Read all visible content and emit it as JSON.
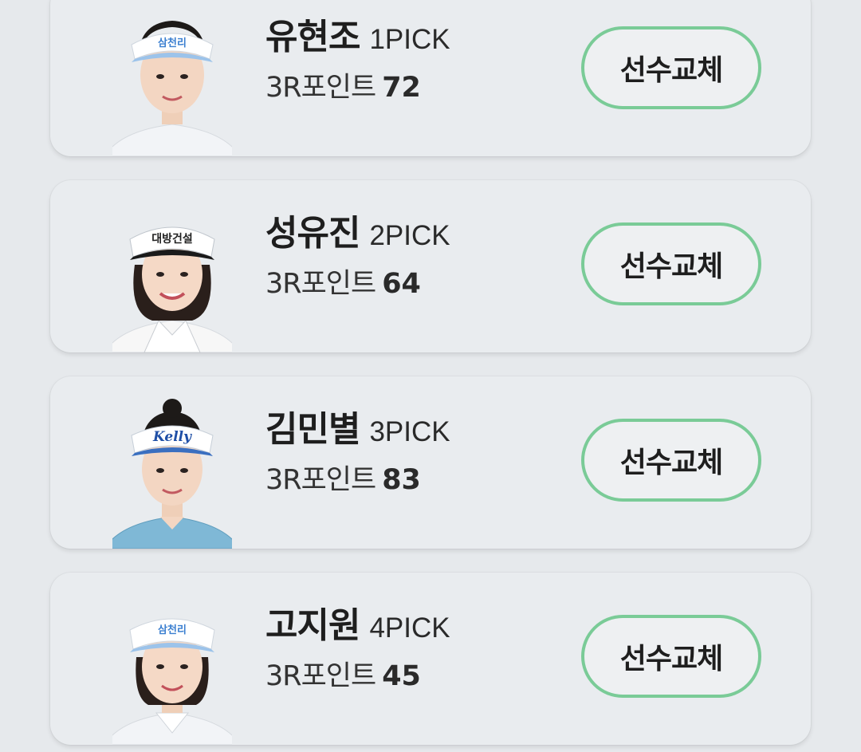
{
  "players": [
    {
      "name": "유현조",
      "pick": "1PICK",
      "points_label": "3R포인트",
      "points": "72",
      "button_label": "선수교체",
      "visor_text": "삼천리",
      "visor_color": "#3b7fd0",
      "shirt_color": "#f2f4f7"
    },
    {
      "name": "성유진",
      "pick": "2PICK",
      "points_label": "3R포인트",
      "points": "64",
      "button_label": "선수교체",
      "visor_text": "대방건설",
      "visor_color": "#222222",
      "shirt_color": "#f7f7f7"
    },
    {
      "name": "김민별",
      "pick": "3PICK",
      "points_label": "3R포인트",
      "points": "83",
      "button_label": "선수교체",
      "visor_text": "Kelly",
      "visor_color": "#1f4fa6",
      "shirt_color": "#7fb8d6"
    },
    {
      "name": "고지원",
      "pick": "4PICK",
      "points_label": "3R포인트",
      "points": "45",
      "button_label": "선수교체",
      "visor_text": "삼천리",
      "visor_color": "#3b7fd0",
      "shirt_color": "#f2f4f7"
    }
  ],
  "theme": {
    "accent_border": "#7acb97",
    "card_background": "#e9ecef",
    "page_background": "#e6e9ec"
  }
}
